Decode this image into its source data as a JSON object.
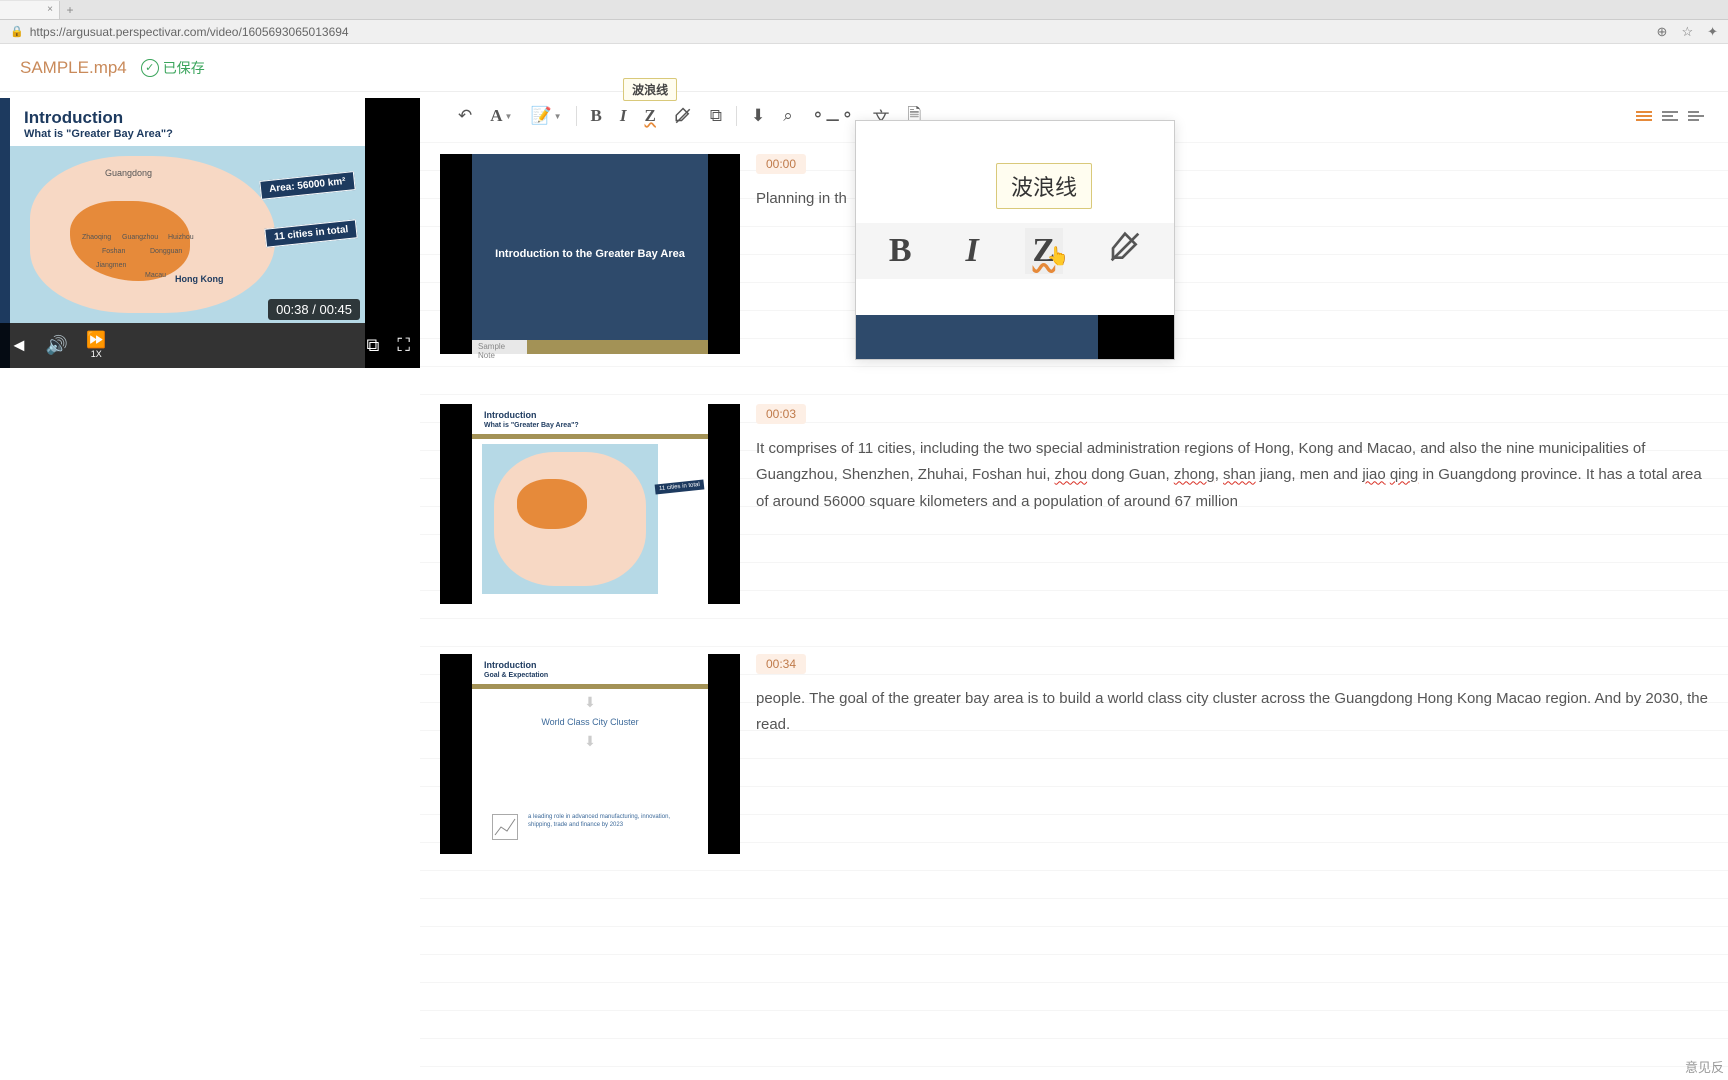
{
  "browser": {
    "url": "https://argusuat.perspectivar.com/video/1605693065013694",
    "tab_close": "×",
    "tab_new": "+",
    "icons": {
      "zoom": "⊕",
      "star": "☆",
      "ext": "✦"
    }
  },
  "header": {
    "filename": "SAMPLE.mp4",
    "saved_label": "已保存",
    "check": "✓"
  },
  "video": {
    "title": "Introduction",
    "subtitle": "What is \"Greater Bay Area\"?",
    "time_badge": "00:38 / 00:45",
    "speed": "1X",
    "labels": {
      "guangdong": "Guangdong",
      "hongkong": "Hong Kong",
      "zhaoqing": "Zhaoqing",
      "guangzhou": "Guangzhou",
      "huizhou": "Huizhou",
      "foshan": "Foshan",
      "dongguan": "Dongguan",
      "jiangmen": "Jiangmen",
      "macau": "Macau"
    },
    "banner_area": "Area: 56000 km²",
    "banner_cities": "11 cities in total"
  },
  "toolbar": {
    "tooltip": "波浪线",
    "font_letter": "A",
    "bold": "B",
    "italic": "I",
    "wavy": "Z"
  },
  "popup": {
    "tooltip": "波浪线",
    "bold": "B",
    "italic": "I",
    "wavy": "Z"
  },
  "blocks": [
    {
      "ts": "00:00",
      "text": "Planning in th",
      "thumb_title": "Introduction to the Greater Bay Area",
      "thumb_note": "Sample Note"
    },
    {
      "ts": "00:03",
      "text_parts": [
        "It comprises of 11 cities, including the two special administration regions of Hong, Kong and Macao, and also the nine municipalities of Guangzhou, Shenzhen, Zhuhai, Foshan hui, ",
        {
          "wavy": "zhou"
        },
        " dong Guan, ",
        {
          "wavy": "zhong"
        },
        ", ",
        {
          "wavy": "shan"
        },
        " jiang, men and ",
        {
          "wavy": "jiao"
        },
        " ",
        {
          "wavy": "qing"
        },
        " in Guangdong province. It has a total area of around 56000 square kilometers and a population of around 67 million"
      ],
      "thumb_title": "Introduction",
      "thumb_sub": "What is \"Greater Bay Area\"?",
      "thumb_banner": "11 cities in total"
    },
    {
      "ts": "00:34",
      "text": "people. The goal of the greater bay area is to build a world class city cluster across the Guangdong Hong Kong Macao region. And by 2030, the read.",
      "thumb_title": "Introduction",
      "thumb_sub": "Goal & Expectation",
      "thumb_cluster": "World Class City Cluster",
      "thumb_desc": "a leading role in advanced manufacturing, innovation, shipping, trade and finance by 2023"
    }
  ],
  "footer": {
    "feedback": "意见反"
  }
}
